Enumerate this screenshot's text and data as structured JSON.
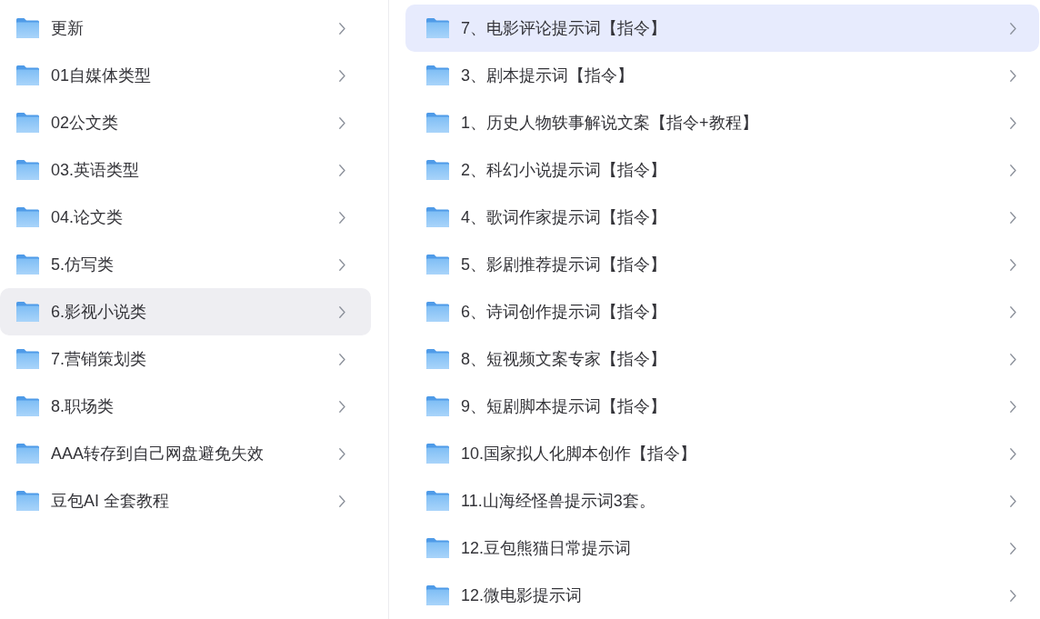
{
  "left_panel": {
    "items": [
      {
        "label": "更新",
        "selected": false
      },
      {
        "label": "01自媒体类型",
        "selected": false
      },
      {
        "label": "02公文类",
        "selected": false
      },
      {
        "label": "03.英语类型",
        "selected": false
      },
      {
        "label": "04.论文类",
        "selected": false
      },
      {
        "label": "5.仿写类",
        "selected": false
      },
      {
        "label": "6.影视小说类",
        "selected": true
      },
      {
        "label": "7.营销策划类",
        "selected": false
      },
      {
        "label": "8.职场类",
        "selected": false
      },
      {
        "label": "AAA转存到自己网盘避免失效",
        "selected": false
      },
      {
        "label": "豆包AI 全套教程",
        "selected": false
      }
    ]
  },
  "right_panel": {
    "items": [
      {
        "label": "7、电影评论提示词【指令】",
        "selected": true
      },
      {
        "label": "3、剧本提示词【指令】",
        "selected": false
      },
      {
        "label": "1、历史人物轶事解说文案【指令+教程】",
        "selected": false
      },
      {
        "label": "2、科幻小说提示词【指令】",
        "selected": false
      },
      {
        "label": "4、歌词作家提示词【指令】",
        "selected": false
      },
      {
        "label": "5、影剧推荐提示词【指令】",
        "selected": false
      },
      {
        "label": "6、诗词创作提示词【指令】",
        "selected": false
      },
      {
        "label": "8、短视频文案专家【指令】",
        "selected": false
      },
      {
        "label": "9、短剧脚本提示词【指令】",
        "selected": false
      },
      {
        "label": "10.国家拟人化脚本创作【指令】",
        "selected": false
      },
      {
        "label": "11.山海经怪兽提示词3套。",
        "selected": false
      },
      {
        "label": "12.豆包熊猫日常提示词",
        "selected": false
      },
      {
        "label": "12.微电影提示词",
        "selected": false
      }
    ]
  }
}
